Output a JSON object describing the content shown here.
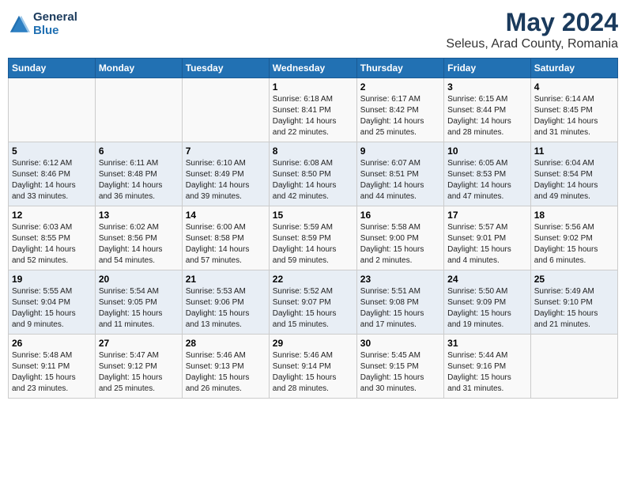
{
  "logo": {
    "line1": "General",
    "line2": "Blue"
  },
  "title": "May 2024",
  "subtitle": "Seleus, Arad County, Romania",
  "days_of_week": [
    "Sunday",
    "Monday",
    "Tuesday",
    "Wednesday",
    "Thursday",
    "Friday",
    "Saturday"
  ],
  "weeks": [
    [
      {
        "day": "",
        "info": ""
      },
      {
        "day": "",
        "info": ""
      },
      {
        "day": "",
        "info": ""
      },
      {
        "day": "1",
        "info": "Sunrise: 6:18 AM\nSunset: 8:41 PM\nDaylight: 14 hours\nand 22 minutes."
      },
      {
        "day": "2",
        "info": "Sunrise: 6:17 AM\nSunset: 8:42 PM\nDaylight: 14 hours\nand 25 minutes."
      },
      {
        "day": "3",
        "info": "Sunrise: 6:15 AM\nSunset: 8:44 PM\nDaylight: 14 hours\nand 28 minutes."
      },
      {
        "day": "4",
        "info": "Sunrise: 6:14 AM\nSunset: 8:45 PM\nDaylight: 14 hours\nand 31 minutes."
      }
    ],
    [
      {
        "day": "5",
        "info": "Sunrise: 6:12 AM\nSunset: 8:46 PM\nDaylight: 14 hours\nand 33 minutes."
      },
      {
        "day": "6",
        "info": "Sunrise: 6:11 AM\nSunset: 8:48 PM\nDaylight: 14 hours\nand 36 minutes."
      },
      {
        "day": "7",
        "info": "Sunrise: 6:10 AM\nSunset: 8:49 PM\nDaylight: 14 hours\nand 39 minutes."
      },
      {
        "day": "8",
        "info": "Sunrise: 6:08 AM\nSunset: 8:50 PM\nDaylight: 14 hours\nand 42 minutes."
      },
      {
        "day": "9",
        "info": "Sunrise: 6:07 AM\nSunset: 8:51 PM\nDaylight: 14 hours\nand 44 minutes."
      },
      {
        "day": "10",
        "info": "Sunrise: 6:05 AM\nSunset: 8:53 PM\nDaylight: 14 hours\nand 47 minutes."
      },
      {
        "day": "11",
        "info": "Sunrise: 6:04 AM\nSunset: 8:54 PM\nDaylight: 14 hours\nand 49 minutes."
      }
    ],
    [
      {
        "day": "12",
        "info": "Sunrise: 6:03 AM\nSunset: 8:55 PM\nDaylight: 14 hours\nand 52 minutes."
      },
      {
        "day": "13",
        "info": "Sunrise: 6:02 AM\nSunset: 8:56 PM\nDaylight: 14 hours\nand 54 minutes."
      },
      {
        "day": "14",
        "info": "Sunrise: 6:00 AM\nSunset: 8:58 PM\nDaylight: 14 hours\nand 57 minutes."
      },
      {
        "day": "15",
        "info": "Sunrise: 5:59 AM\nSunset: 8:59 PM\nDaylight: 14 hours\nand 59 minutes."
      },
      {
        "day": "16",
        "info": "Sunrise: 5:58 AM\nSunset: 9:00 PM\nDaylight: 15 hours\nand 2 minutes."
      },
      {
        "day": "17",
        "info": "Sunrise: 5:57 AM\nSunset: 9:01 PM\nDaylight: 15 hours\nand 4 minutes."
      },
      {
        "day": "18",
        "info": "Sunrise: 5:56 AM\nSunset: 9:02 PM\nDaylight: 15 hours\nand 6 minutes."
      }
    ],
    [
      {
        "day": "19",
        "info": "Sunrise: 5:55 AM\nSunset: 9:04 PM\nDaylight: 15 hours\nand 9 minutes."
      },
      {
        "day": "20",
        "info": "Sunrise: 5:54 AM\nSunset: 9:05 PM\nDaylight: 15 hours\nand 11 minutes."
      },
      {
        "day": "21",
        "info": "Sunrise: 5:53 AM\nSunset: 9:06 PM\nDaylight: 15 hours\nand 13 minutes."
      },
      {
        "day": "22",
        "info": "Sunrise: 5:52 AM\nSunset: 9:07 PM\nDaylight: 15 hours\nand 15 minutes."
      },
      {
        "day": "23",
        "info": "Sunrise: 5:51 AM\nSunset: 9:08 PM\nDaylight: 15 hours\nand 17 minutes."
      },
      {
        "day": "24",
        "info": "Sunrise: 5:50 AM\nSunset: 9:09 PM\nDaylight: 15 hours\nand 19 minutes."
      },
      {
        "day": "25",
        "info": "Sunrise: 5:49 AM\nSunset: 9:10 PM\nDaylight: 15 hours\nand 21 minutes."
      }
    ],
    [
      {
        "day": "26",
        "info": "Sunrise: 5:48 AM\nSunset: 9:11 PM\nDaylight: 15 hours\nand 23 minutes."
      },
      {
        "day": "27",
        "info": "Sunrise: 5:47 AM\nSunset: 9:12 PM\nDaylight: 15 hours\nand 25 minutes."
      },
      {
        "day": "28",
        "info": "Sunrise: 5:46 AM\nSunset: 9:13 PM\nDaylight: 15 hours\nand 26 minutes."
      },
      {
        "day": "29",
        "info": "Sunrise: 5:46 AM\nSunset: 9:14 PM\nDaylight: 15 hours\nand 28 minutes."
      },
      {
        "day": "30",
        "info": "Sunrise: 5:45 AM\nSunset: 9:15 PM\nDaylight: 15 hours\nand 30 minutes."
      },
      {
        "day": "31",
        "info": "Sunrise: 5:44 AM\nSunset: 9:16 PM\nDaylight: 15 hours\nand 31 minutes."
      },
      {
        "day": "",
        "info": ""
      }
    ]
  ]
}
